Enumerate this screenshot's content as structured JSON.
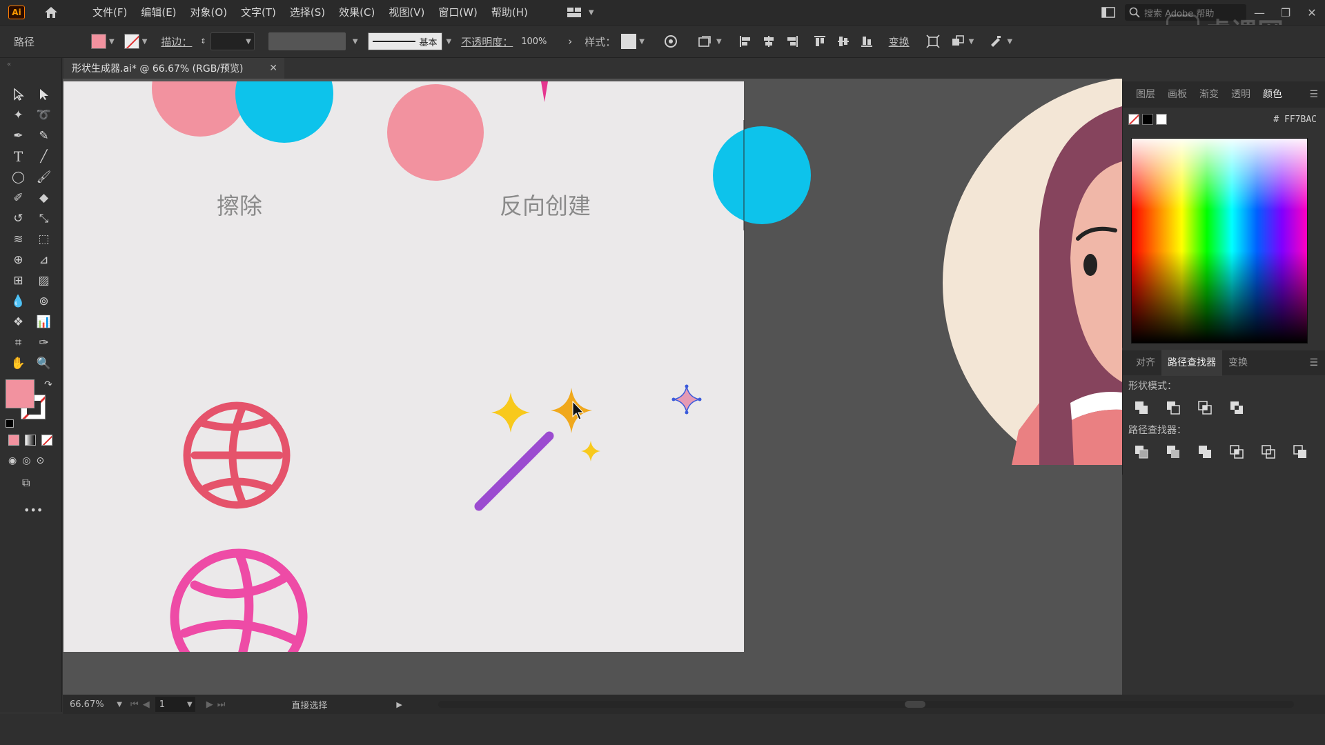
{
  "app": {
    "logo_text": "Ai"
  },
  "menu": [
    "文件(F)",
    "编辑(E)",
    "对象(O)",
    "文字(T)",
    "选择(S)",
    "效果(C)",
    "视图(V)",
    "窗口(W)",
    "帮助(H)"
  ],
  "search": {
    "placeholder": "搜索 Adobe 帮助"
  },
  "watermark": "虎课网",
  "control": {
    "object_type": "路径",
    "stroke_label": "描边：",
    "profile_label": "基本",
    "opacity_label": "不透明度：",
    "opacity_value": "100%",
    "style_label": "样式：",
    "transform_label": "变换",
    "fill_color": "#F2929F"
  },
  "document": {
    "tab_title": "形状生成器.ai* @ 66.67% (RGB/预览)"
  },
  "artboard": {
    "text_erase": "擦除",
    "text_reverse": "反向创建"
  },
  "panels": {
    "color_tabs": [
      "图层",
      "画板",
      "渐变",
      "透明",
      "颜色"
    ],
    "active_color_tab": "颜色",
    "hex_prefix": "#",
    "hex_value": "FF7BAC",
    "path_tabs": [
      "对齐",
      "路径查找器",
      "变换"
    ],
    "active_path_tab": "路径查找器",
    "shape_mode_label": "形状模式：",
    "pathfinder_label": "路径查找器："
  },
  "status": {
    "zoom": "66.67%",
    "page": "1",
    "tool_name": "直接选择"
  },
  "colors": {
    "pink": "#F2929F",
    "cyan": "#0DC3EB",
    "red_ball": "#E5536B",
    "magenta_ball": "#EE4BA6",
    "wand": "#9B4BD0",
    "sparkle": "#F8C91C",
    "accent_hex": "#FF7BAC"
  }
}
